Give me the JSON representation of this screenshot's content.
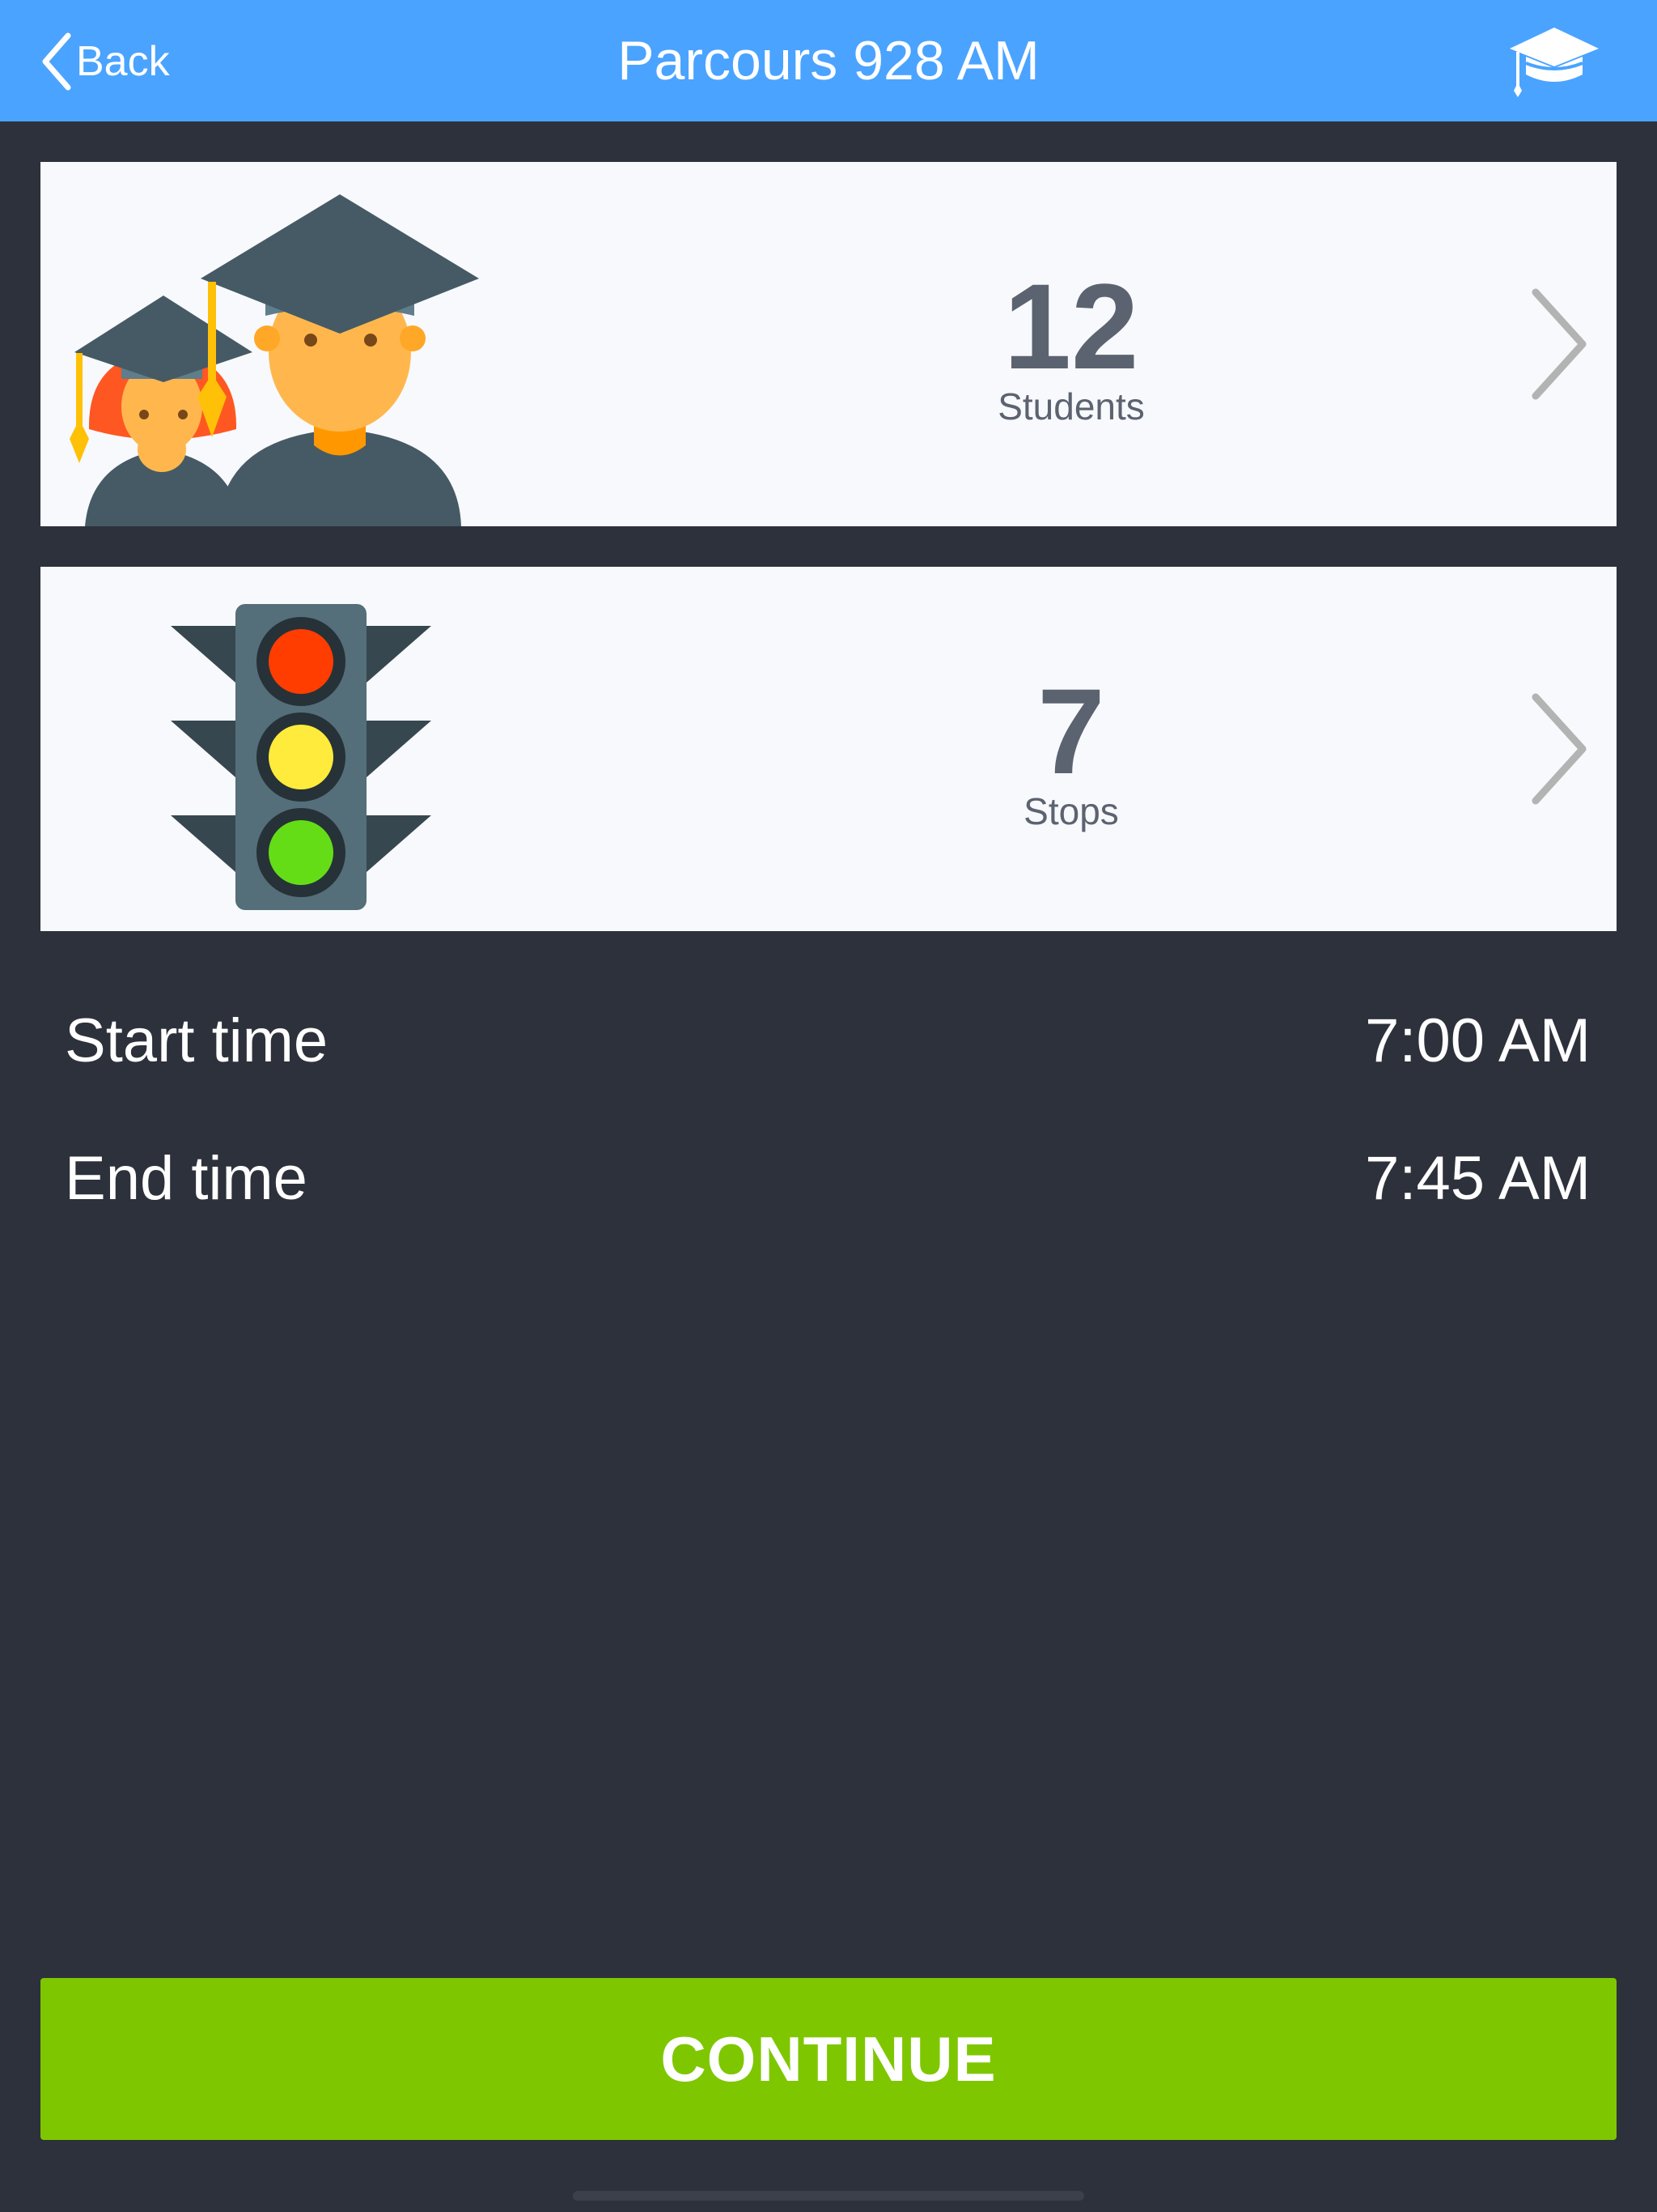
{
  "navbar": {
    "back_label": "Back",
    "title": "Parcours 928 AM",
    "right_icon": "graduation-cap-icon"
  },
  "cards": {
    "students": {
      "count": "12",
      "label": "Students",
      "icon": "students-icon"
    },
    "stops": {
      "count": "7",
      "label": "Stops",
      "icon": "traffic-light-icon"
    }
  },
  "details": {
    "start_label": "Start time",
    "start_value": "7:00 AM",
    "end_label": "End time",
    "end_value": "7:45 AM"
  },
  "actions": {
    "continue_label": "CONTINUE"
  },
  "colors": {
    "navbar": "#4aa3ff",
    "background": "#2d313b",
    "card": "#f8f9fc",
    "continue": "#7ec700"
  }
}
